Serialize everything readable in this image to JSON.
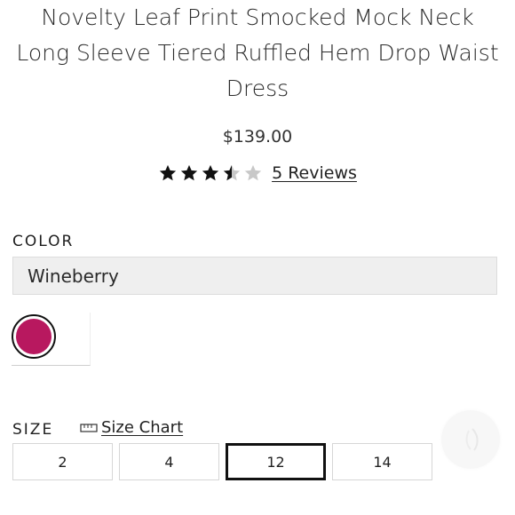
{
  "product": {
    "title_line1": "Novelty Leaf Print Smocked Mock Neck",
    "title_line2": "Long Sleeve Tiered Ruffled Hem Drop Waist",
    "title_line3": "Dress",
    "price": "$139.00",
    "rating": 3.5,
    "rating_max": 5,
    "reviews_label": "5 Reviews"
  },
  "color": {
    "label": "COLOR",
    "selected": "Wineberry",
    "swatch_color": "#b8185f"
  },
  "size": {
    "label": "SIZE",
    "chart_label": "Size Chart",
    "options": [
      "2",
      "4",
      "12",
      "14"
    ],
    "selected": "12"
  },
  "icons": {
    "star": "star-icon",
    "ruler": "ruler-icon",
    "floating": "floating-action-icon"
  },
  "colors": {
    "star_filled": "#111111",
    "star_empty": "#c8c8c8",
    "selected_border": "#111111"
  }
}
